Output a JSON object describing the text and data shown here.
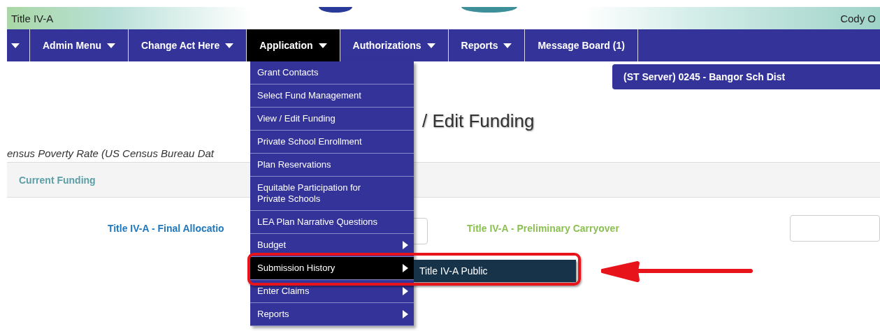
{
  "header": {
    "title": "Title IV-A",
    "user": "Cody O"
  },
  "nav": [
    {
      "kind": "caret",
      "selected": false
    },
    {
      "kind": "dropdown",
      "label": "Admin Menu",
      "selected": false
    },
    {
      "kind": "dropdown",
      "label": "Change Act Here",
      "selected": false
    },
    {
      "kind": "dropdown",
      "label": "Application",
      "selected": true
    },
    {
      "kind": "dropdown",
      "label": "Authorizations",
      "selected": false
    },
    {
      "kind": "dropdown",
      "label": "Reports",
      "selected": false
    },
    {
      "kind": "link",
      "label": "Message Board (1)",
      "selected": false
    }
  ],
  "menu": {
    "items": [
      {
        "label": "Grant Contacts",
        "kind": "link",
        "selected": false
      },
      {
        "label": "Select Fund Management",
        "kind": "link",
        "selected": false
      },
      {
        "label": "View / Edit Funding",
        "kind": "link",
        "selected": false
      },
      {
        "label": "Private School Enrollment",
        "kind": "link",
        "selected": false
      },
      {
        "label": "Plan Reservations",
        "kind": "link",
        "selected": false
      },
      {
        "label": "Equitable Participation for Private Schools",
        "kind": "link",
        "selected": false
      },
      {
        "label": "LEA Plan Narrative Questions",
        "kind": "link",
        "selected": false
      },
      {
        "label": "Budget",
        "kind": "submenu",
        "selected": false
      },
      {
        "label": "Submission History",
        "kind": "submenu",
        "selected": true
      },
      {
        "label": "Enter Claims",
        "kind": "submenu",
        "selected": false
      },
      {
        "label": "Reports",
        "kind": "submenu",
        "selected": false
      }
    ],
    "submenu": {
      "items": [
        {
          "label": "Title IV-A Public"
        }
      ]
    }
  },
  "server": "(ST Server) 0245 - Bangor Sch Dist",
  "page": {
    "title": "/ Edit Funding",
    "census": "ensus Poverty Rate (US Census Bureau Dat",
    "section": "Current Funding",
    "allocation_label": "Title IV-A - Final Allocatio",
    "carryover_label": "Title IV-A - Preliminary Carryover"
  }
}
